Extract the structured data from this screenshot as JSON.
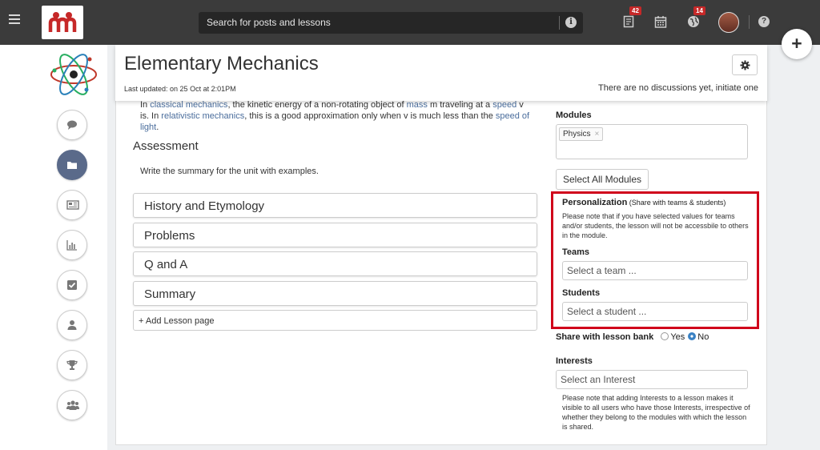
{
  "topbar": {
    "search_placeholder": "Search for posts and lessons",
    "notes_count": "42",
    "globe_count": "14",
    "colors": {
      "bar": "#3b3b3b",
      "badge": "#c62828",
      "logo_red": "#c62828"
    }
  },
  "header": {
    "title": "Elementary Mechanics",
    "updated": "Last updated: on 25 Oct at 2:01PM",
    "discussion": "There are no discussions yet, initiate one"
  },
  "content": {
    "para_1": "In ",
    "link_1": "classical mechanics",
    "para_2": ", the kinetic energy of a non-rotating object of ",
    "link_2": "mass",
    "para_3": " m traveling at a ",
    "link_3": "speed",
    "para_4": " v is. In ",
    "link_4": "relativistic mechanics",
    "para_5": ", this is a good approximation only when v is much less than the ",
    "link_5": "speed of light",
    "para_6": ".",
    "section_title": "Assessment",
    "section_text": "Write the summary for the unit with examples.",
    "pages": [
      "History and Etymology",
      "Problems",
      "Q and A",
      "Summary"
    ],
    "add_page": "+ Add Lesson page"
  },
  "right": {
    "modules_label": "Modules",
    "module_tag": "Physics",
    "tag_remove": "×",
    "select_all": "Select All Modules",
    "personalization_title": "Personalization",
    "personalization_sub": " (Share with teams & students)",
    "personalization_note": "Please note that if you have selected values for teams and/or students, the lesson will not be accessbile to others in the module.",
    "teams_label": "Teams",
    "teams_placeholder": "Select a team ...",
    "students_label": "Students",
    "students_placeholder": "Select a student ...",
    "share_label": "Share with lesson bank",
    "yes": "Yes",
    "no": "No",
    "share_selected": "No",
    "interests_label": "Interests",
    "interests_placeholder": "Select an Interest",
    "interests_note": "Please note that adding Interests to a lesson makes it visible to all users who have those Interests, irrespective of whether they belong to the modules with which the lesson is shared."
  },
  "sidebar": {
    "icons": [
      "chat-icon",
      "folder-icon",
      "newspaper-icon",
      "bar-chart-icon",
      "checkbox-icon",
      "user-icon",
      "trophy-icon",
      "group-icon"
    ],
    "active": "folder-icon"
  }
}
